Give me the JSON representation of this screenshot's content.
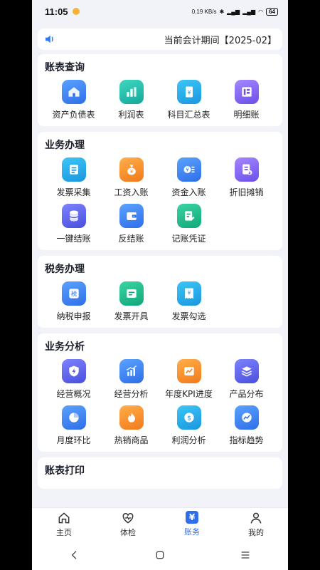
{
  "status": {
    "time": "11:05",
    "net_speed": "0.19 KB/s",
    "battery": "64"
  },
  "notice": {
    "text": "当前会计期间【2025-02】"
  },
  "sections": [
    {
      "title": "账表查询",
      "items": [
        "资产负债表",
        "利润表",
        "科目汇总表",
        "明细账"
      ]
    },
    {
      "title": "业务办理",
      "items": [
        "发票采集",
        "工资入账",
        "资金入账",
        "折旧摊销",
        "一键结账",
        "反结账",
        "记账凭证"
      ]
    },
    {
      "title": "税务办理",
      "items": [
        "纳税申报",
        "发票开具",
        "发票勾选"
      ]
    },
    {
      "title": "业务分析",
      "items": [
        "经营概况",
        "经营分析",
        "年度KPI进度",
        "产品分布",
        "月度环比",
        "热销商品",
        "利润分析",
        "指标趋势"
      ]
    },
    {
      "title": "账表打印"
    }
  ],
  "tabs": [
    "主页",
    "体检",
    "账务",
    "我的"
  ],
  "tab_active_glyph": "¥",
  "icon_glyphs": {
    "tax": "税",
    "yen": "¥"
  }
}
